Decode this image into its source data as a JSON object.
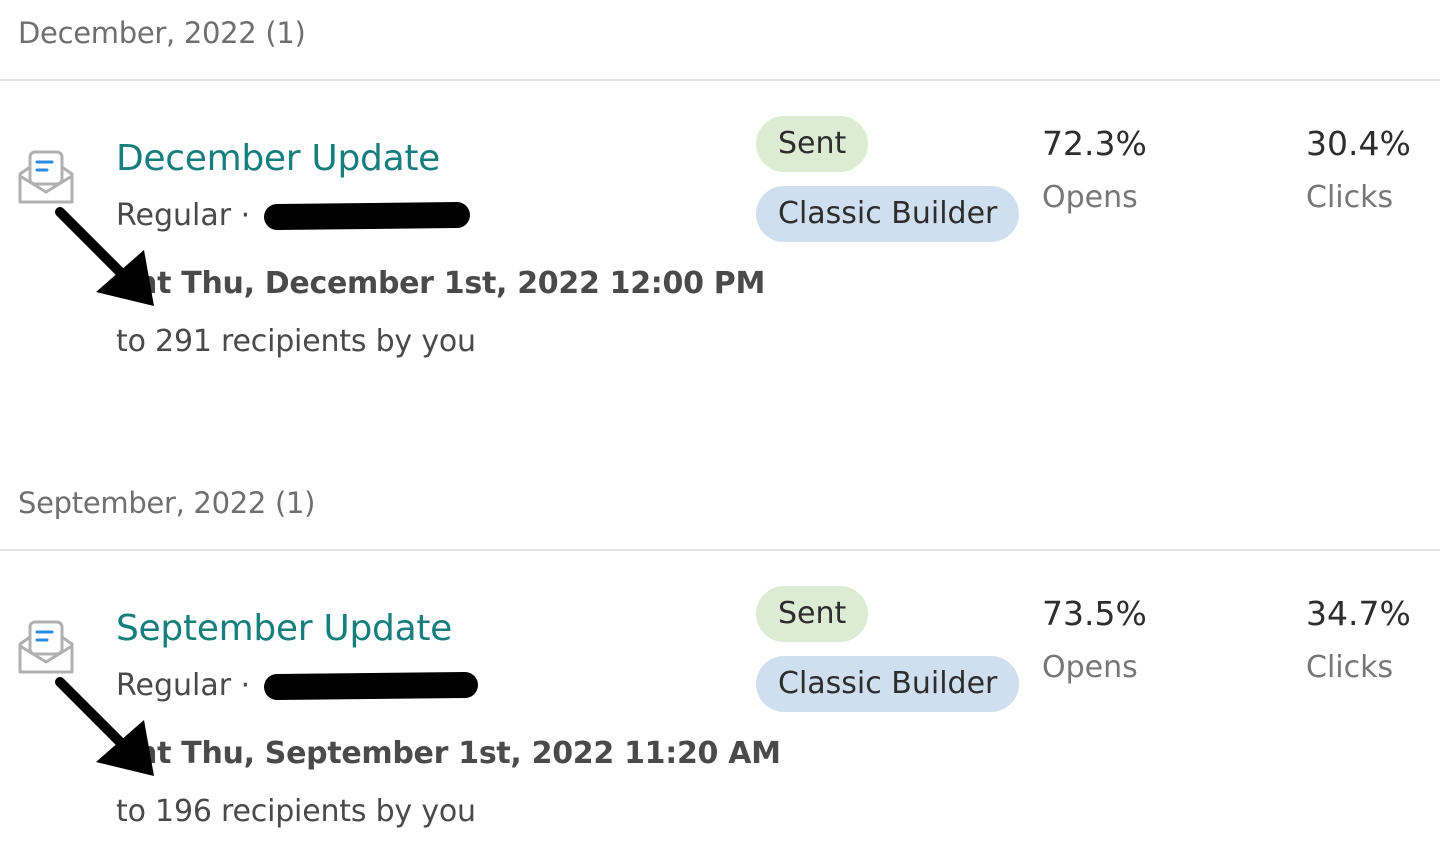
{
  "groups": [
    {
      "header": "December, 2022 (1)",
      "campaign": {
        "title": "December Update",
        "type": "Regular ·",
        "sent": "ent Thu, December 1st, 2022 12:00 PM",
        "recipients": "to 291 recipients by you",
        "status_badge": "Sent",
        "builder_badge": "Classic Builder",
        "opens_value": "72.3%",
        "opens_label": "Opens",
        "clicks_value": "30.4%",
        "clicks_label": "Clicks"
      }
    },
    {
      "header": "September, 2022 (1)",
      "campaign": {
        "title": "September Update",
        "type": "Regular ·",
        "sent": "ent Thu, September 1st, 2022 11:20 AM",
        "recipients": "to 196 recipients by you",
        "status_badge": "Sent",
        "builder_badge": "Classic Builder",
        "opens_value": "73.5%",
        "opens_label": "Opens",
        "clicks_value": "34.7%",
        "clicks_label": "Clicks"
      }
    }
  ],
  "icons": {
    "campaign": "email-open-icon",
    "annotation": "arrow-icon"
  },
  "colors": {
    "title": "#177e7e",
    "sent_badge": "#dcebd3",
    "builder_badge": "#cfdff0",
    "redaction": "#000000"
  }
}
